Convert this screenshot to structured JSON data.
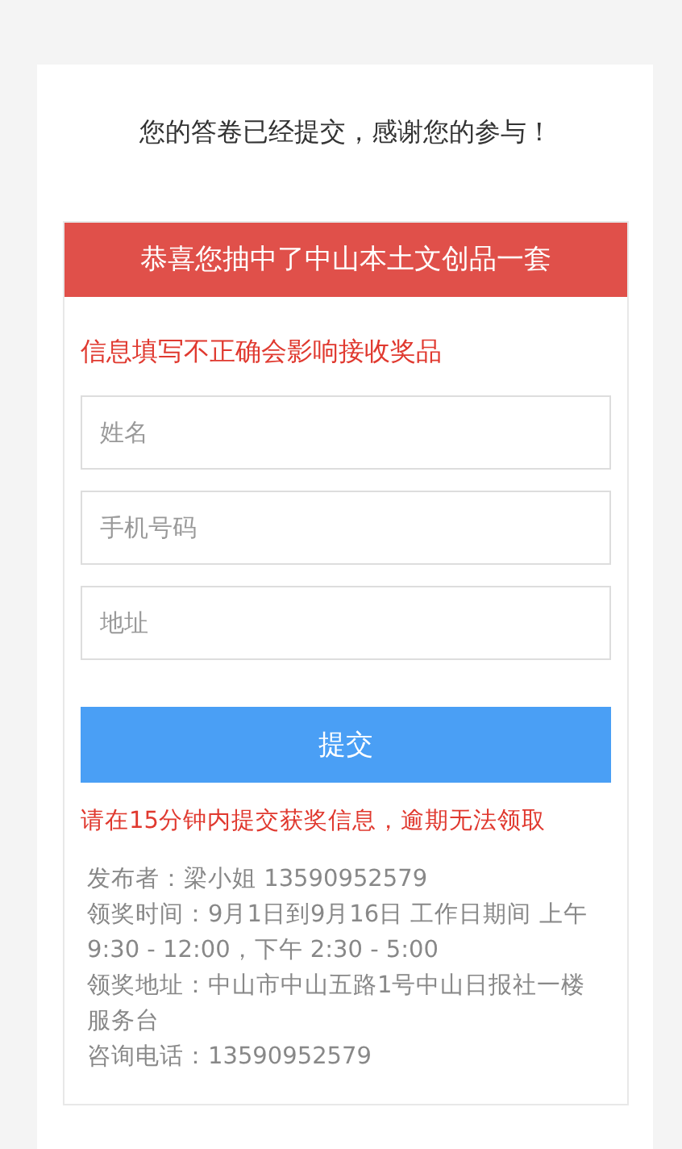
{
  "title": "您的答卷已经提交，感谢您的参与！",
  "prize": {
    "banner": "恭喜您抽中了中山本土文创品一套",
    "warning": "信息填写不正确会影响接收奖品",
    "fields": [
      {
        "placeholder": "姓名"
      },
      {
        "placeholder": "手机号码"
      },
      {
        "placeholder": "地址"
      }
    ],
    "submit": "提交",
    "deadline": "请在15分钟内提交获奖信息，逾期无法领取",
    "details": [
      "发布者：梁小姐  13590952579",
      "领奖时间：9月1日到9月16日 工作日期间 上午 9:30 - 12:00，下午 2:30 - 5:00",
      "领奖地址：中山市中山五路1号中山日报社一楼服务台",
      "咨询电话：13590952579"
    ]
  }
}
